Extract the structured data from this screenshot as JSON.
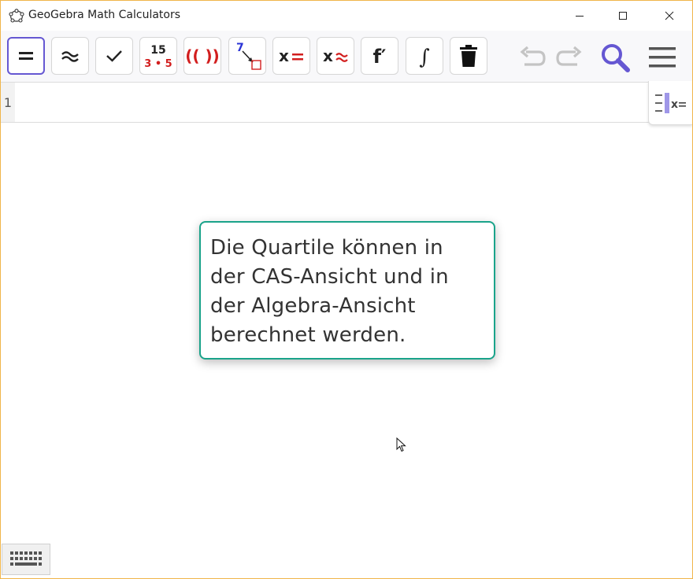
{
  "window": {
    "title": "GeoGebra Math Calculators",
    "border_color": "#f0b54a"
  },
  "toolbar": {
    "tools": [
      {
        "name": "evaluate",
        "icon": "equals-icon",
        "active": true
      },
      {
        "name": "numeric",
        "icon": "approx-icon"
      },
      {
        "name": "keep-input",
        "icon": "checkmark-icon"
      },
      {
        "name": "factor",
        "icon": "factor-icon",
        "top": "15",
        "bottom": "3 • 5"
      },
      {
        "name": "expand",
        "icon": "expand-icon",
        "label": "(( ))"
      },
      {
        "name": "substitute",
        "icon": "substitute-icon",
        "label": "7"
      },
      {
        "name": "solve",
        "icon": "solve-icon",
        "label": "x="
      },
      {
        "name": "solve-numerically",
        "icon": "solve-numeric-icon",
        "label": "x≈"
      },
      {
        "name": "derivative",
        "icon": "derivative-icon",
        "label": "f′"
      },
      {
        "name": "integral",
        "icon": "integral-icon",
        "label": "∫"
      },
      {
        "name": "delete",
        "icon": "trash-icon"
      }
    ],
    "undo_icon": "undo-icon",
    "redo_icon": "redo-icon",
    "search_icon": "search-icon",
    "menu_icon": "hamburger-menu-icon",
    "accent": "#6557d2",
    "red": "#d21e1e"
  },
  "cas": {
    "row_number": "1",
    "input_value": ""
  },
  "view_toggle_icon": "algebra-view-icon",
  "tooltip": {
    "text": "Die Quartile können in der CAS-Ansicht und in der Algebra-Ansicht berechnet werden.",
    "border_color": "#1aa38a"
  },
  "keyboard_icon": "keyboard-icon"
}
